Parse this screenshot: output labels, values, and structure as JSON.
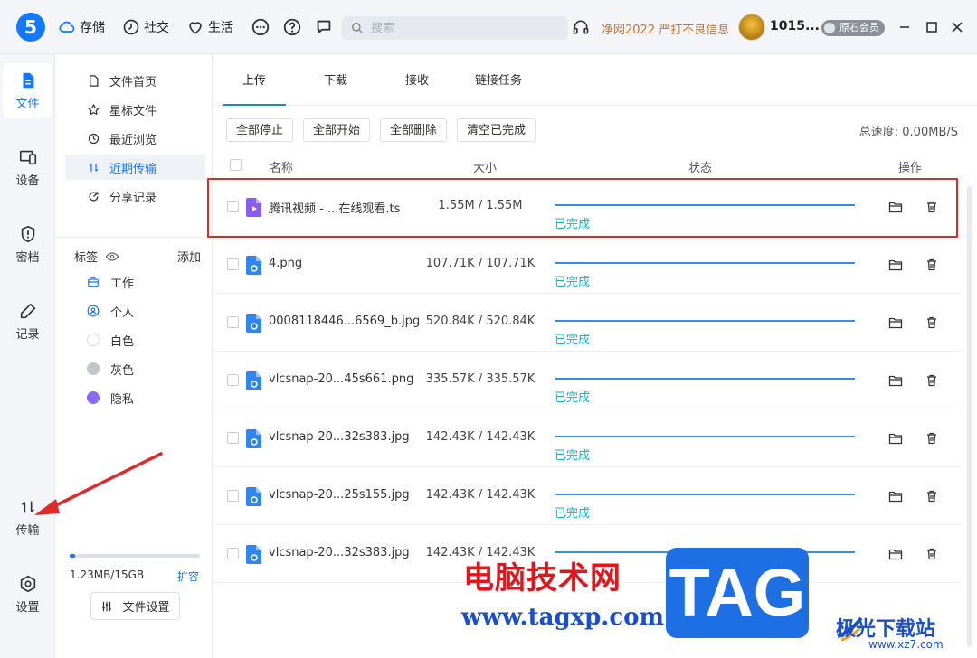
{
  "app": {
    "logo": "5",
    "topnav": [
      {
        "label": "存储",
        "icon": "cloud-icon"
      },
      {
        "label": "社交",
        "icon": "clock-icon"
      },
      {
        "label": "生活",
        "icon": "heart-icon"
      }
    ],
    "search_placeholder": "搜索",
    "promo": "净网2022 严打不良信息",
    "username": "1015...",
    "vip_badge": "原石会员"
  },
  "rail": [
    {
      "label": "文件",
      "icon": "file-icon",
      "active": true
    },
    {
      "label": "设备",
      "icon": "devices-icon"
    },
    {
      "label": "密档",
      "icon": "shield-icon"
    },
    {
      "label": "记录",
      "icon": "pen-icon"
    },
    {
      "label": "传输",
      "icon": "transfer-icon"
    },
    {
      "label": "设置",
      "icon": "settings-icon"
    }
  ],
  "sidenav": [
    {
      "label": "文件首页",
      "icon": "file-outline-icon"
    },
    {
      "label": "星标文件",
      "icon": "star-icon"
    },
    {
      "label": "最近浏览",
      "icon": "history-icon"
    },
    {
      "label": "近期传输",
      "icon": "transfer-icon",
      "active": true
    },
    {
      "label": "分享记录",
      "icon": "share-icon"
    }
  ],
  "tags": {
    "header": "标签",
    "add": "添加",
    "items": [
      {
        "label": "工作",
        "icon": "briefcase-icon"
      },
      {
        "label": "个人",
        "icon": "person-icon"
      },
      {
        "label": "白色",
        "color": "#ffffff"
      },
      {
        "label": "灰色",
        "color": "#c2c4c8"
      },
      {
        "label": "隐私",
        "color": "#8a6cf0"
      }
    ]
  },
  "storage": {
    "used_text": "1.23MB/15GB",
    "expand": "扩容",
    "used_fraction": 0.04
  },
  "file_settings": "文件设置",
  "tabs": [
    "上传",
    "下载",
    "接收",
    "链接任务"
  ],
  "toolbar": {
    "stop_all": "全部停止",
    "start_all": "全部开始",
    "delete_all": "全部删除",
    "clear_done": "清空已完成",
    "speed": "总速度: 0.00MB/S"
  },
  "columns": {
    "name": "名称",
    "size": "大小",
    "status": "状态",
    "actions": "操作"
  },
  "transfers": [
    {
      "name": "腾讯视频 - ...在线观看.ts",
      "size": "1.55M / 1.55M",
      "status": "已完成",
      "progress": 1.0,
      "type": "video"
    },
    {
      "name": "4.png",
      "size": "107.71K / 107.71K",
      "status": "已完成",
      "progress": 1.0,
      "type": "image"
    },
    {
      "name": "0008118446...6569_b.jpg",
      "size": "520.84K / 520.84K",
      "status": "已完成",
      "progress": 1.0,
      "type": "image"
    },
    {
      "name": "vlcsnap-20...45s661.png",
      "size": "335.57K / 335.57K",
      "status": "已完成",
      "progress": 1.0,
      "type": "image"
    },
    {
      "name": "vlcsnap-20...32s383.jpg",
      "size": "142.43K / 142.43K",
      "status": "已完成",
      "progress": 1.0,
      "type": "image"
    },
    {
      "name": "vlcsnap-20...25s155.jpg",
      "size": "142.43K / 142.43K",
      "status": "已完成",
      "progress": 1.0,
      "type": "image"
    },
    {
      "name": "vlcsnap-20...32s383.jpg",
      "size": "142.43K / 142.43K",
      "status": "",
      "progress": 1.0,
      "type": "image"
    }
  ],
  "watermark": {
    "cn": "电脑技术网",
    "url": "www.tagxp.com",
    "tag": "TAG",
    "site2": "极光下载站",
    "site2_url": "www.xz7.com"
  },
  "colors": {
    "accent": "#1677ff",
    "done": "#19b4b4",
    "highlight": "#e02a2a"
  }
}
